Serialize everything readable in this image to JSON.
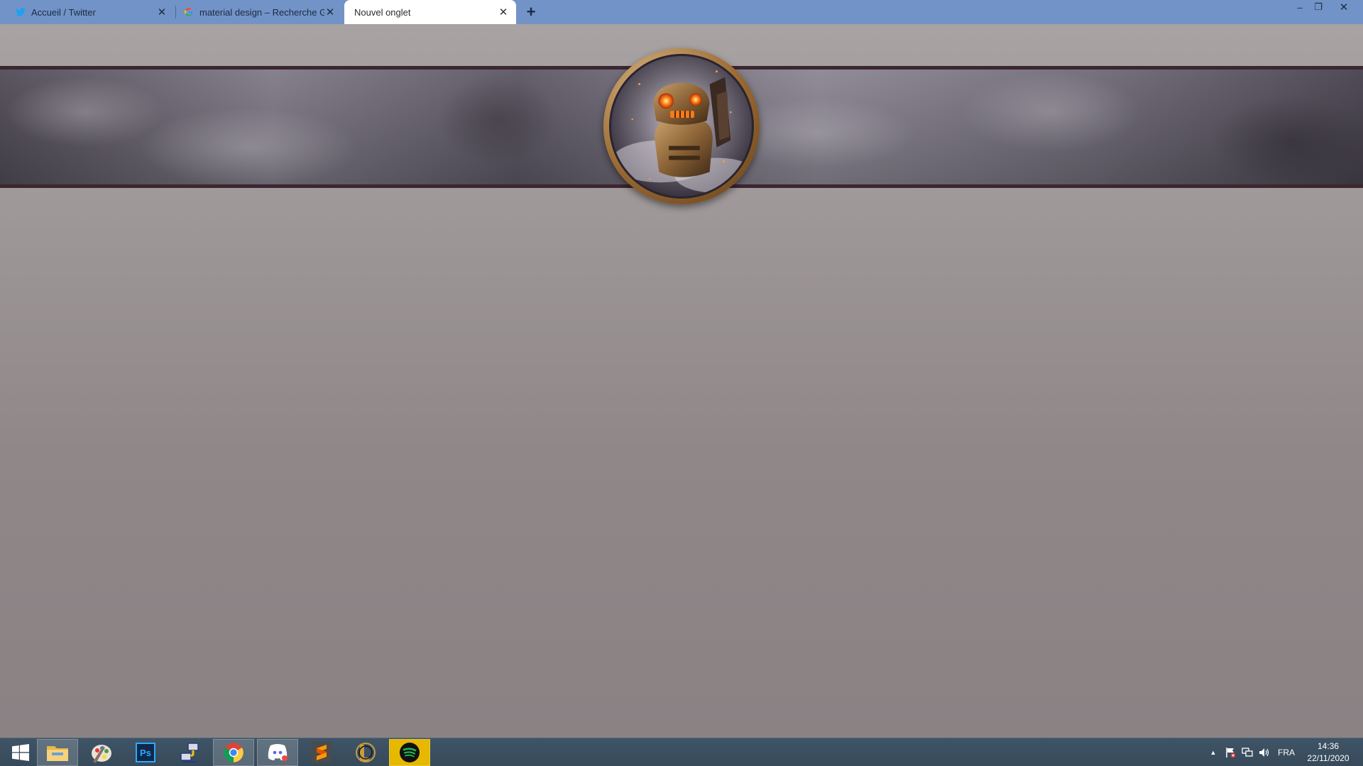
{
  "browser": {
    "tabs": [
      {
        "title": "Accueil / Twitter",
        "favicon": "twitter-icon",
        "active": false
      },
      {
        "title": "material design – Recherche Goo",
        "favicon": "google-icon",
        "active": false
      },
      {
        "title": "Nouvel onglet",
        "favicon": "",
        "active": true
      }
    ],
    "close_glyph": "✕",
    "new_tab_glyph": "+",
    "window_controls": {
      "minimize": "–",
      "maximize": "❐",
      "close": "✕"
    },
    "colors": {
      "tabstrip": "#7193c8",
      "active_tab": "#ffffff"
    }
  },
  "page": {
    "banner": {
      "style": "smoky-grey",
      "border_color": "#3c2630"
    },
    "avatar": {
      "icon": "robot-avatar-icon",
      "ring_color": "#b08048"
    }
  },
  "taskbar": {
    "apps": [
      {
        "name": "start-button",
        "icon": "windows-logo-icon",
        "active": false
      },
      {
        "name": "file-explorer",
        "icon": "folder-icon",
        "active": true
      },
      {
        "name": "paint",
        "icon": "paint-palette-icon",
        "active": false
      },
      {
        "name": "photoshop",
        "icon": "photoshop-icon",
        "label": "Ps",
        "active": false
      },
      {
        "name": "network-tool",
        "icon": "network-tool-icon",
        "active": false
      },
      {
        "name": "chrome",
        "icon": "chrome-icon",
        "active": true
      },
      {
        "name": "discord",
        "icon": "discord-icon",
        "active": true
      },
      {
        "name": "sublime-text",
        "icon": "sublime-text-icon",
        "active": false
      },
      {
        "name": "league-of-legends",
        "icon": "league-of-legends-icon",
        "active": false
      },
      {
        "name": "spotify",
        "icon": "spotify-icon",
        "active": true
      }
    ],
    "tray": {
      "show_hidden": "▲",
      "language": "FRA",
      "time": "14:36",
      "date": "22/11/2020"
    },
    "colors": {
      "background": "#3b4f60",
      "spotify_highlight": "#e6b800"
    }
  }
}
